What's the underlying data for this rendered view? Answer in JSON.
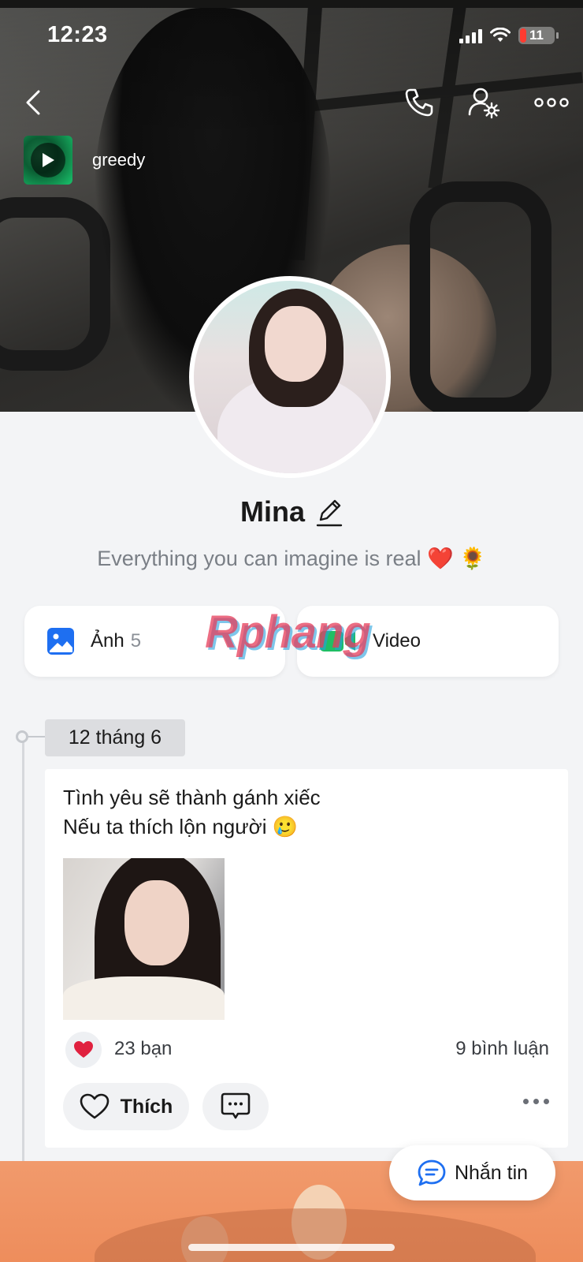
{
  "status_bar": {
    "time": "12:23",
    "battery": "11",
    "battery_color": "#ff3b30"
  },
  "header": {
    "back_icon": "chevron-left-icon",
    "call_icon": "phone-icon",
    "settings_icon": "user-gear-icon",
    "more_icon": "ellipsis-icon"
  },
  "music": {
    "title": "greedy",
    "icon": "play-icon",
    "accent": "#19c36c"
  },
  "profile": {
    "name": "Mina",
    "bio": "Everything you can imagine is real ❤️ 🌻"
  },
  "media": {
    "photos": {
      "label": "Ảnh",
      "count": "5",
      "icon": "image-icon",
      "color": "#1e6ff1"
    },
    "videos": {
      "label": "Video",
      "icon": "video-icon",
      "color": "#1fbf64"
    }
  },
  "watermark": "Rphang",
  "timeline": {
    "date": "12 tháng 6",
    "post": {
      "lines": [
        "Tình yêu sẽ thành gánh xiếc",
        "Nếu ta thích lộn người 🥲"
      ],
      "reactions": "23 bạn",
      "comments": "9 bình luận",
      "like_label": "Thích",
      "heart_color": "#e0213f"
    }
  },
  "message_button": {
    "label": "Nhắn tin",
    "icon": "chat-bubble-icon",
    "color": "#1e6ff1"
  }
}
